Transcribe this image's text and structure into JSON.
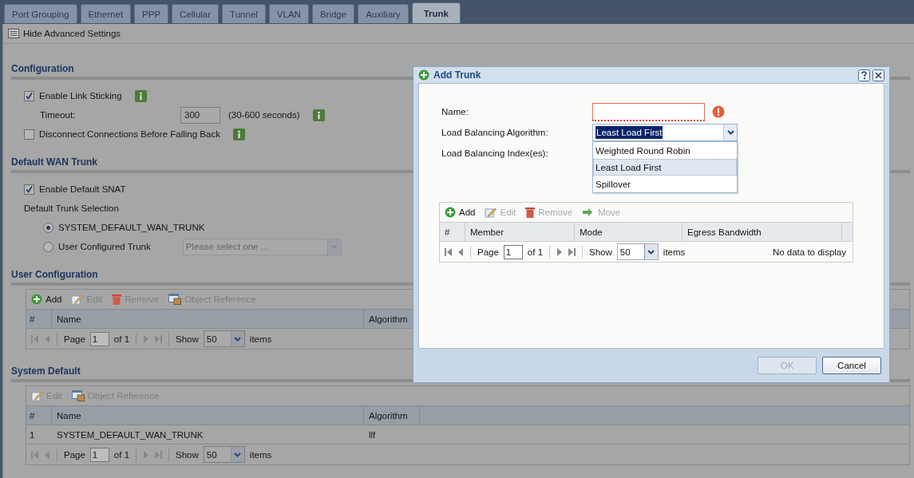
{
  "tabs": [
    {
      "label": "Port Grouping",
      "selected": false
    },
    {
      "label": "Ethernet",
      "selected": false
    },
    {
      "label": "PPP",
      "selected": false
    },
    {
      "label": "Cellular",
      "selected": false
    },
    {
      "label": "Tunnel",
      "selected": false
    },
    {
      "label": "VLAN",
      "selected": false
    },
    {
      "label": "Bridge",
      "selected": false
    },
    {
      "label": "Auxiliary",
      "selected": false
    },
    {
      "label": "Trunk",
      "selected": true
    }
  ],
  "toolbar": {
    "label": "Hide Advanced Settings"
  },
  "configuration": {
    "title": "Configuration",
    "link_sticking": {
      "label": "Enable Link Sticking",
      "checked": true
    },
    "timeout": {
      "label": "Timeout:",
      "value": "300",
      "hint": "(30-600 seconds)"
    },
    "disconnect": {
      "label": "Disconnect Connections Before Falling Back",
      "checked": false
    }
  },
  "default_wan_trunk": {
    "title": "Default WAN Trunk",
    "snat": {
      "label": "Enable Default SNAT",
      "checked": true
    },
    "selection_label": "Default Trunk Selection",
    "options": [
      {
        "label": "SYSTEM_DEFAULT_WAN_TRUNK",
        "selected": true
      },
      {
        "label": "User Configured Trunk",
        "selected": false
      }
    ],
    "trunk_select": {
      "placeholder": "Please select one ...",
      "disabled": true
    }
  },
  "user_configuration": {
    "title": "User Configuration",
    "actions": [
      {
        "label": "Add",
        "kind": "add",
        "disabled": false
      },
      {
        "label": "Edit",
        "kind": "edit",
        "disabled": true
      },
      {
        "label": "Remove",
        "kind": "remove",
        "disabled": true
      },
      {
        "label": "Object Reference",
        "kind": "reference",
        "disabled": true
      }
    ],
    "columns": [
      "#",
      "Name",
      "Algorithm"
    ],
    "pager": {
      "page_label": "Page",
      "page": "1",
      "of": "of 1",
      "show_label": "Show",
      "show": "50",
      "items_label": "items"
    }
  },
  "system_default": {
    "title": "System Default",
    "actions": [
      {
        "label": "Edit",
        "kind": "edit",
        "disabled": true
      },
      {
        "label": "Object Reference",
        "kind": "reference",
        "disabled": true
      }
    ],
    "columns": [
      "#",
      "Name",
      "Algorithm"
    ],
    "rows": [
      [
        "1",
        "SYSTEM_DEFAULT_WAN_TRUNK",
        "llf"
      ]
    ],
    "pager": {
      "page_label": "Page",
      "page": "1",
      "of": "of 1",
      "show_label": "Show",
      "show": "50",
      "items_label": "items"
    }
  },
  "dialog": {
    "title": "Add Trunk",
    "name": {
      "label": "Name:",
      "invalid": true
    },
    "algorithm": {
      "label": "Load Balancing Algorithm:",
      "value": "Least Load First",
      "expanded": true,
      "options": [
        {
          "label": "Weighted Round Robin",
          "selected": false
        },
        {
          "label": "Least Load First",
          "selected": true
        },
        {
          "label": "Spillover",
          "selected": false
        }
      ]
    },
    "index": {
      "label": "Load Balancing Index(es):"
    },
    "actions": [
      {
        "label": "Add",
        "kind": "add",
        "disabled": false
      },
      {
        "label": "Edit",
        "kind": "edit",
        "disabled": true
      },
      {
        "label": "Remove",
        "kind": "remove",
        "disabled": true
      },
      {
        "label": "Move",
        "kind": "move",
        "disabled": true
      }
    ],
    "columns": [
      "#",
      "Member",
      "Mode",
      "Egress Bandwidth"
    ],
    "pager": {
      "page_label": "Page",
      "page": "1",
      "of": "of 1",
      "show_label": "Show",
      "show": "50",
      "items_label": "items"
    },
    "empty_text": "No data to display",
    "buttons": [
      {
        "label": "OK",
        "disabled": true
      },
      {
        "label": "Cancel",
        "disabled": false
      }
    ]
  }
}
